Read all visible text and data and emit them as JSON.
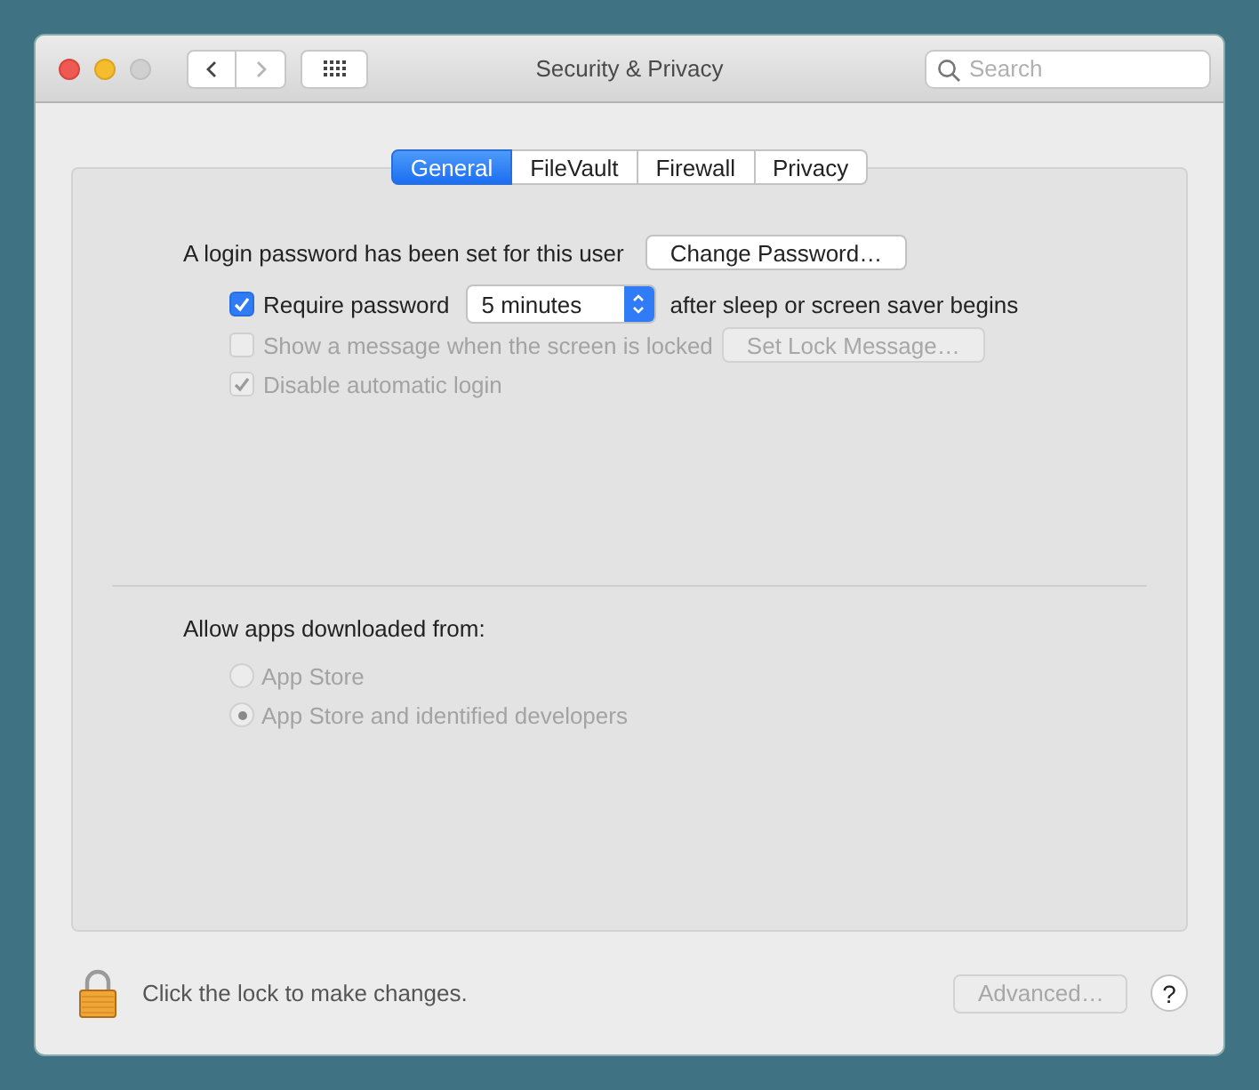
{
  "window": {
    "title": "Security & Privacy"
  },
  "toolbar": {
    "back": {
      "disabled": false
    },
    "forward": {
      "disabled": true
    },
    "search": {
      "placeholder": "Search"
    }
  },
  "tabs": [
    {
      "label": "General",
      "selected": true
    },
    {
      "label": "FileVault",
      "selected": false
    },
    {
      "label": "Firewall",
      "selected": false
    },
    {
      "label": "Privacy",
      "selected": false
    }
  ],
  "login": {
    "text": "A login password has been set for this user",
    "button": "Change Password…"
  },
  "options": [
    {
      "kind": "select",
      "label": "Require password",
      "checked": true,
      "disabled": false,
      "value": "5 minutes",
      "suffix": "after sleep or screen saver begins"
    },
    {
      "kind": "button",
      "label": "Show a message when the screen is locked",
      "checked": false,
      "disabled": true,
      "button": "Set Lock Message…"
    },
    {
      "kind": "plain",
      "label": "Disable automatic login",
      "checked": true,
      "disabled": true
    }
  ],
  "allow": {
    "label": "Allow apps downloaded from:",
    "choices": [
      {
        "label": "App Store",
        "selected": false,
        "disabled": true
      },
      {
        "label": "App Store and identified developers",
        "selected": true,
        "disabled": true
      }
    ]
  },
  "footer": {
    "lock_text": "Click the lock to make changes.",
    "advanced": {
      "label": "Advanced…",
      "disabled": true
    },
    "help": "?"
  }
}
